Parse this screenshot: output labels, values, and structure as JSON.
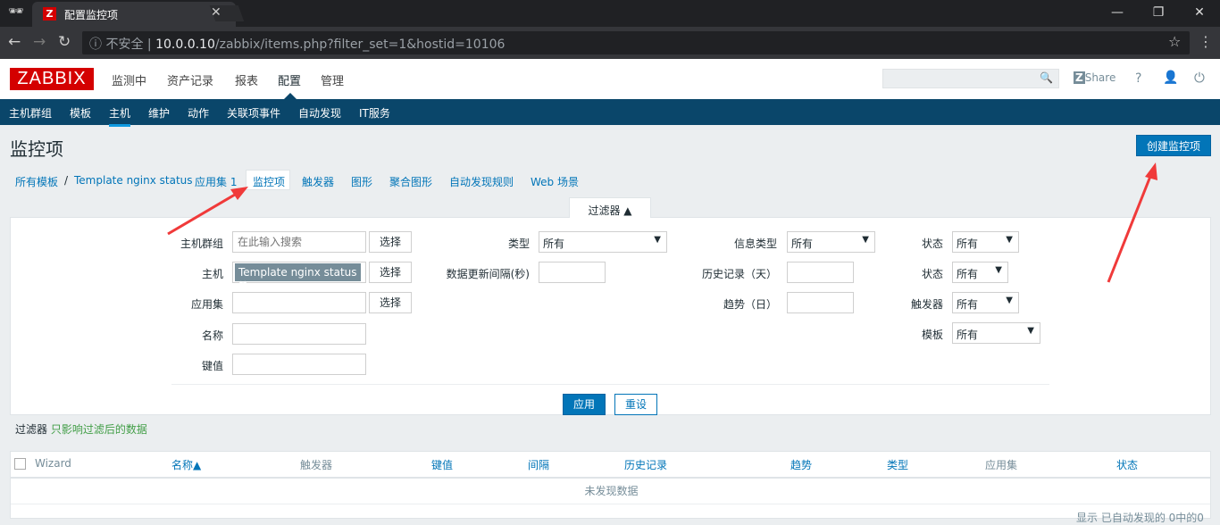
{
  "browser": {
    "tab_title": "配置监控项",
    "insecure": "不安全",
    "url_host": "10.0.0.10",
    "url_path": "/zabbix/items.php?filter_set=1&hostid=10106"
  },
  "logo": "ZABBIX",
  "main_menu": [
    "监测中",
    "资产记录",
    "报表",
    "配置",
    "管理"
  ],
  "header": {
    "share": "Share",
    "help": "?"
  },
  "sub_menu": [
    "主机群组",
    "模板",
    "主机",
    "维护",
    "动作",
    "关联项事件",
    "自动发现",
    "IT服务"
  ],
  "page": {
    "title": "监控项",
    "create_button": "创建监控项"
  },
  "breadcrumb": [
    "所有模板",
    "/",
    "Template nginx status",
    "应用集 1",
    "监控项",
    "触发器",
    "图形",
    "聚合图形",
    "自动发现规则",
    "Web 场景"
  ],
  "filter": {
    "tab": "过滤器 ▲",
    "host_group_label": "主机群组",
    "host_group_placeholder": "在此输入搜索",
    "select": "选择",
    "host_label": "主机",
    "host_chip": "Template nginx status",
    "app_label": "应用集",
    "name_label": "名称",
    "key_label": "键值",
    "type_label": "类型",
    "type_value": "所有",
    "interval_label": "数据更新间隔(秒)",
    "info_type_label": "信息类型",
    "info_type_value": "所有",
    "history_label": "历史记录（天）",
    "trends_label": "趋势（日）",
    "state_label": "状态",
    "state_value": "所有",
    "status_label": "状态",
    "status_value": "所有",
    "triggers_label": "触发器",
    "triggers_value": "所有",
    "template_label": "模板",
    "template_value": "所有",
    "apply": "应用",
    "reset": "重设",
    "hint_label": "过滤器",
    "hint_text": "只影响过滤后的数据"
  },
  "table": {
    "columns": [
      "Wizard",
      "名称▲",
      "触发器",
      "键值",
      "间隔",
      "历史记录",
      "趋势",
      "类型",
      "应用集",
      "状态"
    ],
    "empty": "未发现数据",
    "footer": "显示 已自动发现的 0中的0"
  }
}
